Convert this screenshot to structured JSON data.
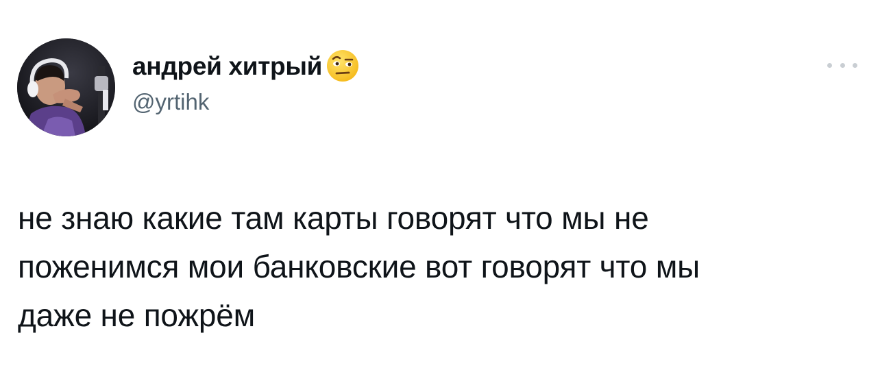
{
  "tweet": {
    "author": {
      "display_name": "андрей хитрый",
      "name_emoji": "face-with-raised-eyebrow-emoji",
      "handle": "@yrtihk",
      "avatar": "avatar-photo-man-with-headphones"
    },
    "more_icon": "more-horizontal-icon",
    "text": "не знаю какие там карты говорят что мы не\nпоженимся мои банковские вот говорят что мы\nдаже не пожрём"
  },
  "colors": {
    "text_primary": "#0f1419",
    "text_secondary": "#536471",
    "more_dots": "#c9ced3",
    "background": "#ffffff"
  }
}
